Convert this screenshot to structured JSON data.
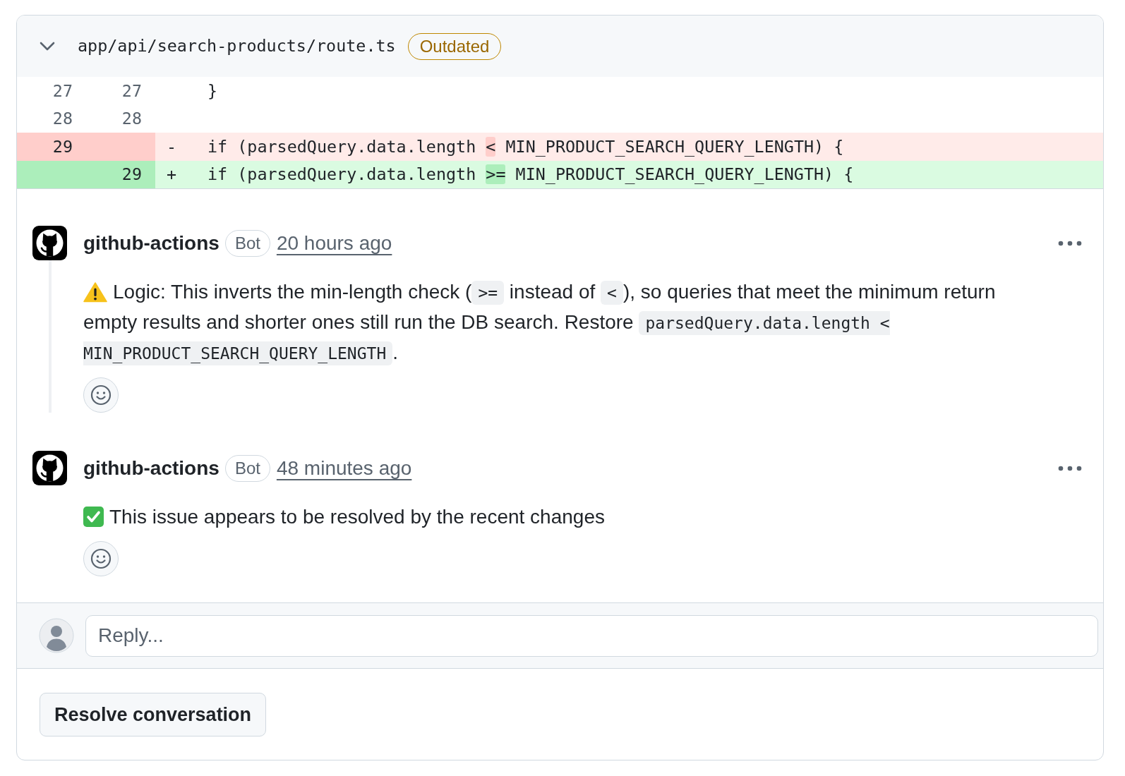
{
  "file": {
    "path": "app/api/search-products/route.ts",
    "expanded": true,
    "badge": "Outdated"
  },
  "diff": {
    "rows": [
      {
        "kind": "context",
        "old_line": "27",
        "new_line": "27",
        "code": [
          {
            "text": "}"
          }
        ]
      },
      {
        "kind": "context",
        "old_line": "28",
        "new_line": "28"
      },
      {
        "kind": "deletion",
        "old_line": "29",
        "marker": "-",
        "code": [
          {
            "text": "if (parsedQuery.data.length ",
            "changed": false
          },
          {
            "text": "<",
            "changed": true
          },
          {
            "text": " MIN_PRODUCT_SEARCH_QUERY_LENGTH) {",
            "changed": false
          }
        ]
      },
      {
        "kind": "addition",
        "new_line": "29",
        "marker": "+",
        "code": [
          {
            "text": "if (parsedQuery.data.length ",
            "changed": false
          },
          {
            "text": ">=",
            "changed": true
          },
          {
            "text": " MIN_PRODUCT_SEARCH_QUERY_LENGTH) {",
            "changed": false
          }
        ]
      }
    ]
  },
  "comments": [
    {
      "kind": "warning",
      "author": "github-actions",
      "badge": "Bot",
      "time": "20 hours ago",
      "body": [
        {
          "kind": "text",
          "text": "Logic: This inverts the min-length check ("
        },
        {
          "kind": "code",
          "text": ">="
        },
        {
          "kind": "text",
          "text": " instead of "
        },
        {
          "kind": "code",
          "text": "<"
        },
        {
          "kind": "text",
          "text": "), so queries that meet the minimum return empty results and shorter ones still run the DB search. Restore "
        },
        {
          "kind": "code",
          "text": "parsedQuery.data.length < MIN_PRODUCT_SEARCH_QUERY_LENGTH"
        },
        {
          "kind": "text",
          "text": "."
        }
      ]
    },
    {
      "kind": "resolved",
      "author": "github-actions",
      "badge": "Bot",
      "time": "48 minutes ago",
      "body": [
        {
          "kind": "text",
          "text": "This issue appears to be resolved by the recent changes"
        }
      ]
    }
  ],
  "reply": {
    "placeholder": "Reply..."
  },
  "actions": [
    {
      "label": "Resolve conversation"
    }
  ]
}
